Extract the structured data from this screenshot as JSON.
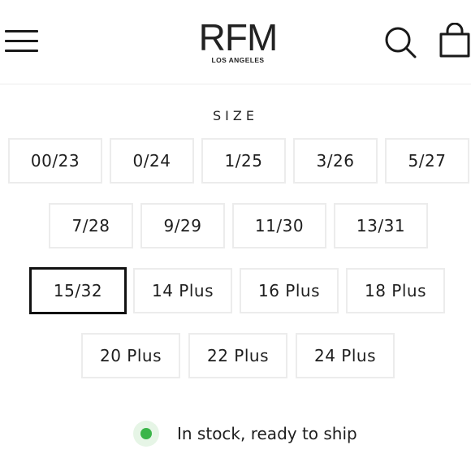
{
  "header": {
    "logo_main": "RFM",
    "logo_sub": "LOS ANGELES",
    "menu_icon": "hamburger-menu-icon",
    "search_icon": "search-icon",
    "cart_icon": "shopping-bag-icon"
  },
  "size": {
    "label": "SIZE",
    "selected": "15/32",
    "options": [
      "00/23",
      "0/24",
      "1/25",
      "3/26",
      "5/27",
      "7/28",
      "9/29",
      "11/30",
      "13/31",
      "15/32",
      "14 Plus",
      "16 Plus",
      "18 Plus",
      "20 Plus",
      "22 Plus",
      "24 Plus"
    ]
  },
  "stock": {
    "text": "In stock, ready to ship",
    "status_color": "#3bb54a"
  }
}
